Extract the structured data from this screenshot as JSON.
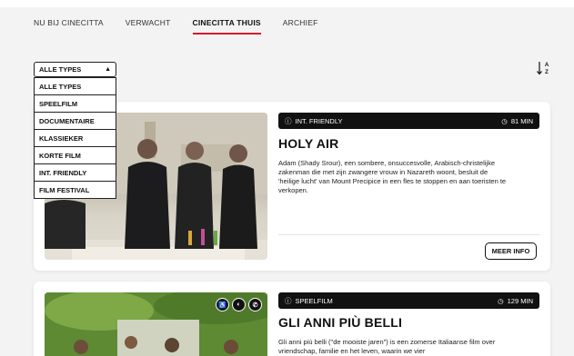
{
  "nav": {
    "items": [
      {
        "label": "NU BIJ CINECITTA"
      },
      {
        "label": "VERWACHT"
      },
      {
        "label": "CINECITTA THUIS"
      },
      {
        "label": "ARCHIEF"
      }
    ],
    "active": "CINECITTA THUIS"
  },
  "sort": {
    "icon": "sort-az-icon",
    "top": "A",
    "bottom": "Z"
  },
  "filter": {
    "selected": "ALLE TYPES",
    "options": [
      "ALLE TYPES",
      "SPEELFILM",
      "DOCUMENTAIRE",
      "KLASSIEKER",
      "KORTE FILM",
      "INT. FRIENDLY",
      "FILM FESTIVAL"
    ]
  },
  "films": [
    {
      "type": "INT. FRIENDLY",
      "duration": "81 MIN",
      "title": "HOLY AIR",
      "description": "Adam (Shady Srour), een sombere, onsuccesvolle, Arabisch-christelijke zakenman die met zijn zwangere vrouw in Nazareth woont, besluit de 'heilige lucht' van Mount Precipice in een fles te stoppen en aan toeristen te verkopen.",
      "more_label": "MEER INFO"
    },
    {
      "type": "SPEELFILM",
      "duration": "129 MIN",
      "title": "GLI ANNI PIÙ BELLI",
      "description": "Gli anni più belli (\"de mooiste jaren\") is een zomerse Italiaanse film over vriendschap, familie en het leven, waarin we vier",
      "badges": [
        "accessibility-icon",
        "audio-description-icon",
        "hearing-icon"
      ]
    }
  ]
}
